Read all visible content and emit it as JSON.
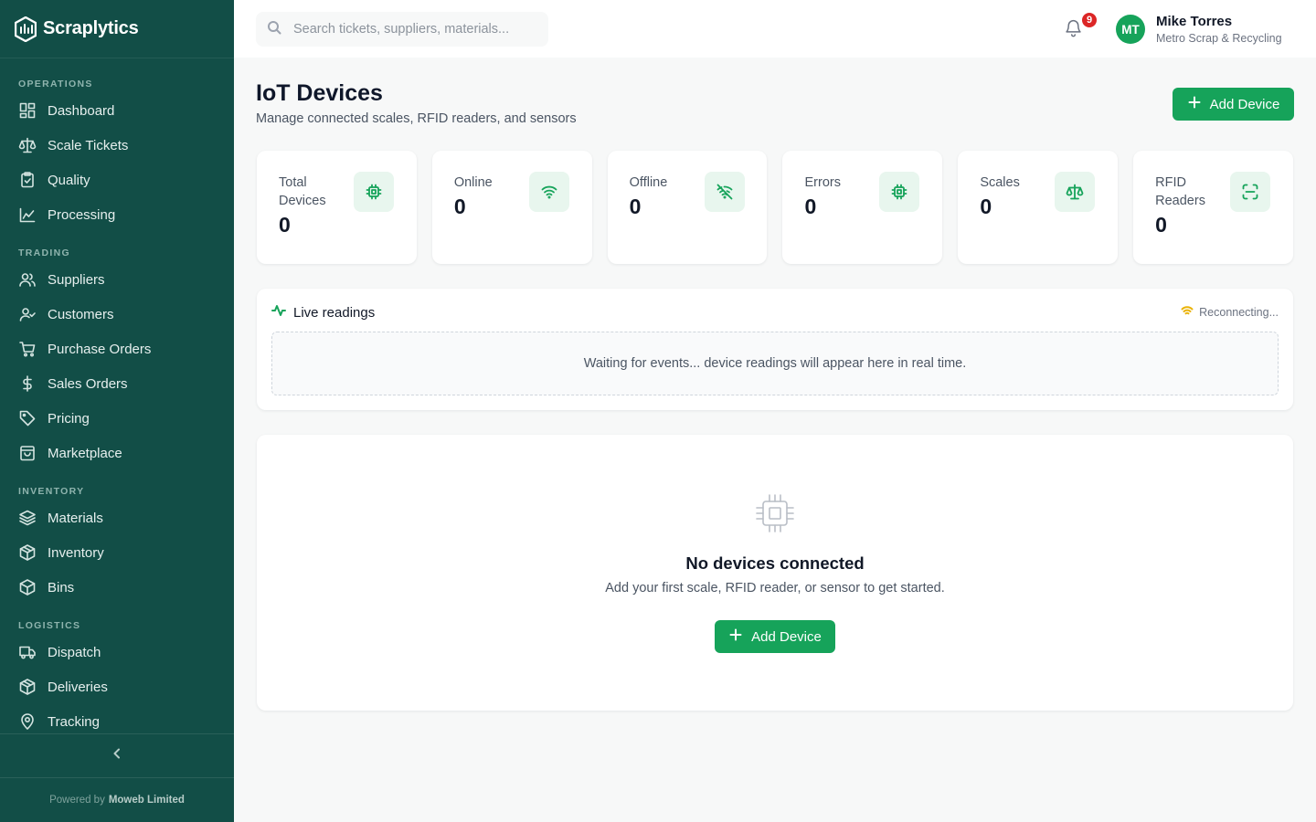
{
  "brand": {
    "name": "Scraplytics"
  },
  "sidebar": {
    "sections": [
      {
        "title": "OPERATIONS",
        "items": [
          "Dashboard",
          "Scale Tickets",
          "Quality",
          "Processing"
        ]
      },
      {
        "title": "TRADING",
        "items": [
          "Suppliers",
          "Customers",
          "Purchase Orders",
          "Sales Orders",
          "Pricing",
          "Marketplace"
        ]
      },
      {
        "title": "INVENTORY",
        "items": [
          "Materials",
          "Inventory",
          "Bins"
        ]
      },
      {
        "title": "LOGISTICS",
        "items": [
          "Dispatch",
          "Deliveries",
          "Tracking"
        ]
      }
    ],
    "powered_prefix": "Powered by",
    "powered_company": "Moweb Limited"
  },
  "topbar": {
    "search_placeholder": "Search tickets, suppliers, materials...",
    "notification_count": "9",
    "user_initials": "MT",
    "user_name": "Mike Torres",
    "user_org": "Metro Scrap & Recycling"
  },
  "page": {
    "title": "IoT Devices",
    "subtitle": "Manage connected scales, RFID readers, and sensors",
    "add_button": "Add Device"
  },
  "stats": [
    {
      "label": "Total Devices",
      "value": "0",
      "icon": "chip-icon"
    },
    {
      "label": "Online",
      "value": "0",
      "icon": "wifi-icon"
    },
    {
      "label": "Offline",
      "value": "0",
      "icon": "wifi-off-icon"
    },
    {
      "label": "Errors",
      "value": "0",
      "icon": "chip-icon"
    },
    {
      "label": "Scales",
      "value": "0",
      "icon": "scale-icon"
    },
    {
      "label": "RFID Readers",
      "value": "0",
      "icon": "scan-icon"
    }
  ],
  "live": {
    "title": "Live readings",
    "status": "Reconnecting...",
    "empty_text": "Waiting for events... device readings will appear here in real time."
  },
  "empty_state": {
    "title": "No devices connected",
    "subtitle": "Add your first scale, RFID reader, or sensor to get started.",
    "button": "Add Device"
  },
  "colors": {
    "sidebar_bg": "#124e47",
    "accent": "#16a35a",
    "badge": "#dc2626",
    "warning": "#eab308"
  }
}
